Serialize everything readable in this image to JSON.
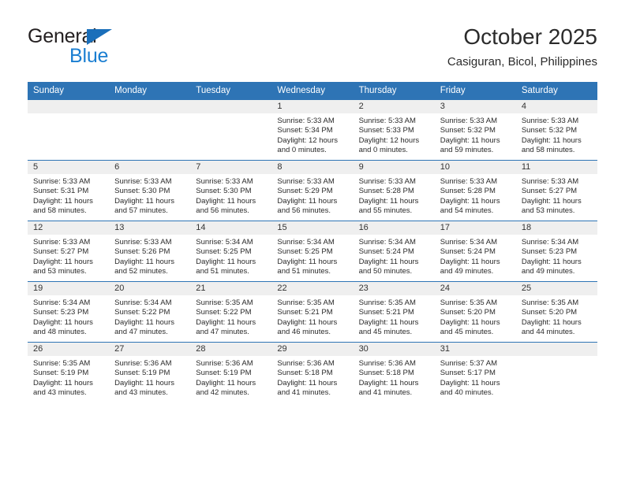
{
  "brand": {
    "name_top": "General",
    "name_bottom": "Blue",
    "triangle_color": "#1a6fba",
    "blue_text_color": "#1a7ed1"
  },
  "header": {
    "title": "October 2025",
    "subtitle": "Casiguran, Bicol, Philippines"
  },
  "theme": {
    "header_blue": "#2e74b5",
    "daynum_band": "#efefef",
    "text": "#2a2a2a"
  },
  "calendar": {
    "weekday_headers": [
      "Sunday",
      "Monday",
      "Tuesday",
      "Wednesday",
      "Thursday",
      "Friday",
      "Saturday"
    ],
    "weeks": [
      [
        {
          "day": "",
          "blank": true
        },
        {
          "day": "",
          "blank": true
        },
        {
          "day": "",
          "blank": true
        },
        {
          "day": "1",
          "sunrise": "Sunrise: 5:33 AM",
          "sunset": "Sunset: 5:34 PM",
          "daylight": "Daylight: 12 hours and 0 minutes."
        },
        {
          "day": "2",
          "sunrise": "Sunrise: 5:33 AM",
          "sunset": "Sunset: 5:33 PM",
          "daylight": "Daylight: 12 hours and 0 minutes."
        },
        {
          "day": "3",
          "sunrise": "Sunrise: 5:33 AM",
          "sunset": "Sunset: 5:32 PM",
          "daylight": "Daylight: 11 hours and 59 minutes."
        },
        {
          "day": "4",
          "sunrise": "Sunrise: 5:33 AM",
          "sunset": "Sunset: 5:32 PM",
          "daylight": "Daylight: 11 hours and 58 minutes."
        }
      ],
      [
        {
          "day": "5",
          "sunrise": "Sunrise: 5:33 AM",
          "sunset": "Sunset: 5:31 PM",
          "daylight": "Daylight: 11 hours and 58 minutes."
        },
        {
          "day": "6",
          "sunrise": "Sunrise: 5:33 AM",
          "sunset": "Sunset: 5:30 PM",
          "daylight": "Daylight: 11 hours and 57 minutes."
        },
        {
          "day": "7",
          "sunrise": "Sunrise: 5:33 AM",
          "sunset": "Sunset: 5:30 PM",
          "daylight": "Daylight: 11 hours and 56 minutes."
        },
        {
          "day": "8",
          "sunrise": "Sunrise: 5:33 AM",
          "sunset": "Sunset: 5:29 PM",
          "daylight": "Daylight: 11 hours and 56 minutes."
        },
        {
          "day": "9",
          "sunrise": "Sunrise: 5:33 AM",
          "sunset": "Sunset: 5:28 PM",
          "daylight": "Daylight: 11 hours and 55 minutes."
        },
        {
          "day": "10",
          "sunrise": "Sunrise: 5:33 AM",
          "sunset": "Sunset: 5:28 PM",
          "daylight": "Daylight: 11 hours and 54 minutes."
        },
        {
          "day": "11",
          "sunrise": "Sunrise: 5:33 AM",
          "sunset": "Sunset: 5:27 PM",
          "daylight": "Daylight: 11 hours and 53 minutes."
        }
      ],
      [
        {
          "day": "12",
          "sunrise": "Sunrise: 5:33 AM",
          "sunset": "Sunset: 5:27 PM",
          "daylight": "Daylight: 11 hours and 53 minutes."
        },
        {
          "day": "13",
          "sunrise": "Sunrise: 5:33 AM",
          "sunset": "Sunset: 5:26 PM",
          "daylight": "Daylight: 11 hours and 52 minutes."
        },
        {
          "day": "14",
          "sunrise": "Sunrise: 5:34 AM",
          "sunset": "Sunset: 5:25 PM",
          "daylight": "Daylight: 11 hours and 51 minutes."
        },
        {
          "day": "15",
          "sunrise": "Sunrise: 5:34 AM",
          "sunset": "Sunset: 5:25 PM",
          "daylight": "Daylight: 11 hours and 51 minutes."
        },
        {
          "day": "16",
          "sunrise": "Sunrise: 5:34 AM",
          "sunset": "Sunset: 5:24 PM",
          "daylight": "Daylight: 11 hours and 50 minutes."
        },
        {
          "day": "17",
          "sunrise": "Sunrise: 5:34 AM",
          "sunset": "Sunset: 5:24 PM",
          "daylight": "Daylight: 11 hours and 49 minutes."
        },
        {
          "day": "18",
          "sunrise": "Sunrise: 5:34 AM",
          "sunset": "Sunset: 5:23 PM",
          "daylight": "Daylight: 11 hours and 49 minutes."
        }
      ],
      [
        {
          "day": "19",
          "sunrise": "Sunrise: 5:34 AM",
          "sunset": "Sunset: 5:23 PM",
          "daylight": "Daylight: 11 hours and 48 minutes."
        },
        {
          "day": "20",
          "sunrise": "Sunrise: 5:34 AM",
          "sunset": "Sunset: 5:22 PM",
          "daylight": "Daylight: 11 hours and 47 minutes."
        },
        {
          "day": "21",
          "sunrise": "Sunrise: 5:35 AM",
          "sunset": "Sunset: 5:22 PM",
          "daylight": "Daylight: 11 hours and 47 minutes."
        },
        {
          "day": "22",
          "sunrise": "Sunrise: 5:35 AM",
          "sunset": "Sunset: 5:21 PM",
          "daylight": "Daylight: 11 hours and 46 minutes."
        },
        {
          "day": "23",
          "sunrise": "Sunrise: 5:35 AM",
          "sunset": "Sunset: 5:21 PM",
          "daylight": "Daylight: 11 hours and 45 minutes."
        },
        {
          "day": "24",
          "sunrise": "Sunrise: 5:35 AM",
          "sunset": "Sunset: 5:20 PM",
          "daylight": "Daylight: 11 hours and 45 minutes."
        },
        {
          "day": "25",
          "sunrise": "Sunrise: 5:35 AM",
          "sunset": "Sunset: 5:20 PM",
          "daylight": "Daylight: 11 hours and 44 minutes."
        }
      ],
      [
        {
          "day": "26",
          "sunrise": "Sunrise: 5:35 AM",
          "sunset": "Sunset: 5:19 PM",
          "daylight": "Daylight: 11 hours and 43 minutes."
        },
        {
          "day": "27",
          "sunrise": "Sunrise: 5:36 AM",
          "sunset": "Sunset: 5:19 PM",
          "daylight": "Daylight: 11 hours and 43 minutes."
        },
        {
          "day": "28",
          "sunrise": "Sunrise: 5:36 AM",
          "sunset": "Sunset: 5:19 PM",
          "daylight": "Daylight: 11 hours and 42 minutes."
        },
        {
          "day": "29",
          "sunrise": "Sunrise: 5:36 AM",
          "sunset": "Sunset: 5:18 PM",
          "daylight": "Daylight: 11 hours and 41 minutes."
        },
        {
          "day": "30",
          "sunrise": "Sunrise: 5:36 AM",
          "sunset": "Sunset: 5:18 PM",
          "daylight": "Daylight: 11 hours and 41 minutes."
        },
        {
          "day": "31",
          "sunrise": "Sunrise: 5:37 AM",
          "sunset": "Sunset: 5:17 PM",
          "daylight": "Daylight: 11 hours and 40 minutes."
        },
        {
          "day": "",
          "blank": true
        }
      ]
    ]
  }
}
